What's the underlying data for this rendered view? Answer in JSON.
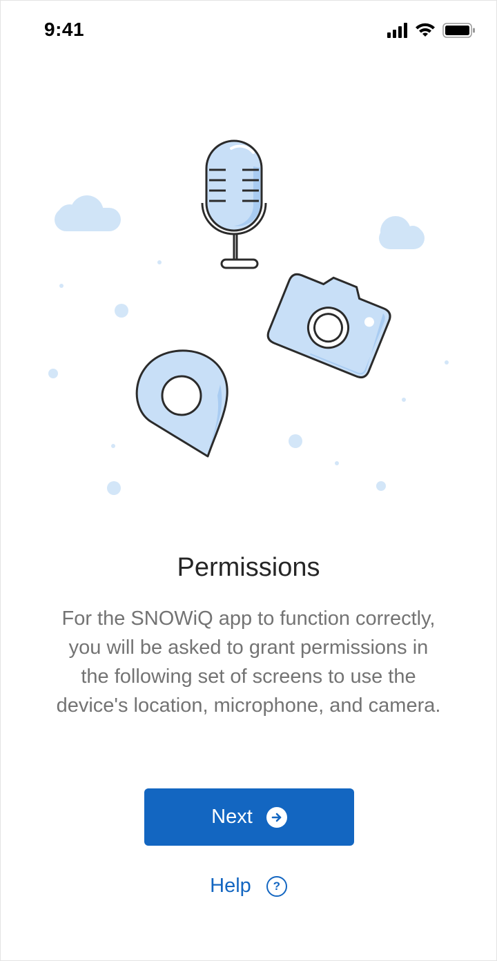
{
  "status_bar": {
    "time": "9:41"
  },
  "illustration": {
    "icons": [
      "microphone-icon",
      "camera-icon",
      "location-pin-icon",
      "cloud-icon"
    ],
    "colors": {
      "fill": "#c8dff7",
      "shade": "#a9ccf2",
      "stroke": "#2b2b2b",
      "dot": "#d3e6f8"
    }
  },
  "content": {
    "title": "Permissions",
    "description": "For the SNOWiQ app to function correctly, you will be asked to grant permissions in the following set of screens to use the device's location, microphone, and camera."
  },
  "actions": {
    "next_label": "Next",
    "next_icon": "arrow-right-circle-icon",
    "help_label": "Help",
    "help_icon": "question-circle-icon",
    "help_icon_glyph": "?"
  },
  "colors": {
    "accent": "#1366c1",
    "title_text": "#262626",
    "body_text": "#737373"
  }
}
